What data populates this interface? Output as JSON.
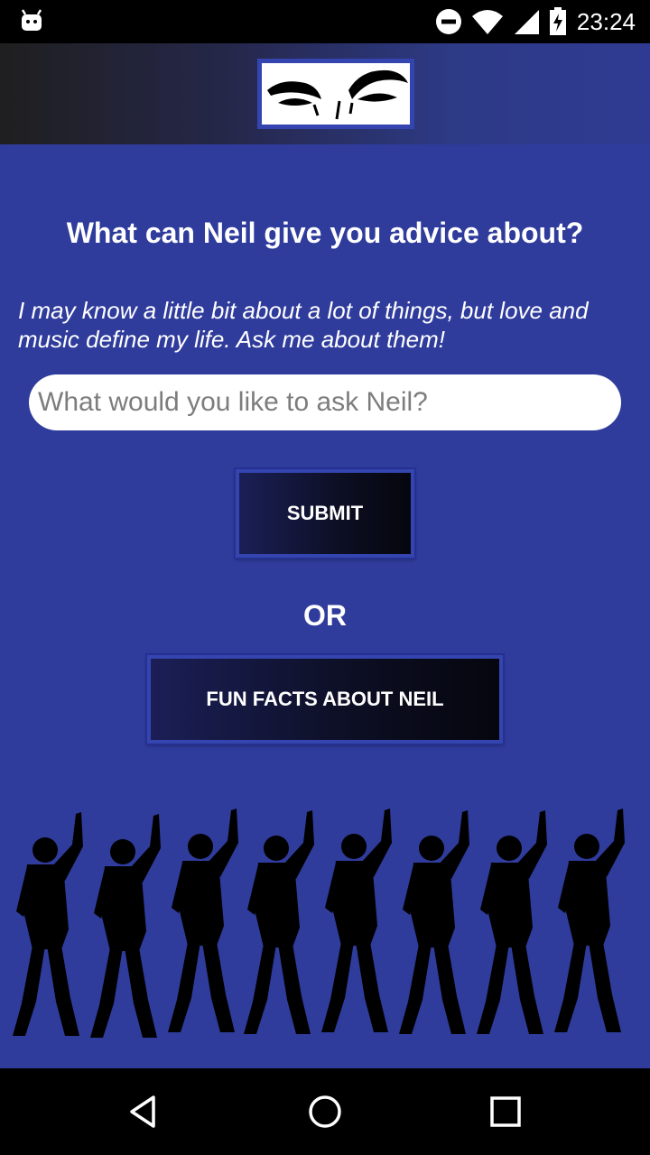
{
  "status_bar": {
    "time": "23:24",
    "icons": [
      "android-debug-icon",
      "do-not-disturb-icon",
      "wifi-icon",
      "cell-signal-icon",
      "battery-charging-icon"
    ]
  },
  "header": {
    "logo": "eyebrows-logo"
  },
  "main": {
    "headline": "What can Neil give you advice about?",
    "intro": "I may know a little bit about a lot of things, but love and music define my life. Ask me about them!",
    "ask_placeholder": "What would you like to ask Neil?",
    "submit_label": "SUBMIT",
    "or_label": "OR",
    "fun_facts_label": "FUN FACTS ABOUT NEIL"
  },
  "decoration": {
    "image": "dancing-silhouettes"
  },
  "nav_bar": {
    "buttons": [
      "back-icon",
      "home-icon",
      "recents-icon"
    ]
  },
  "colors": {
    "background": "#2f3c9c",
    "button_border": "#3445b0",
    "button_fill": "#0c0e22"
  }
}
